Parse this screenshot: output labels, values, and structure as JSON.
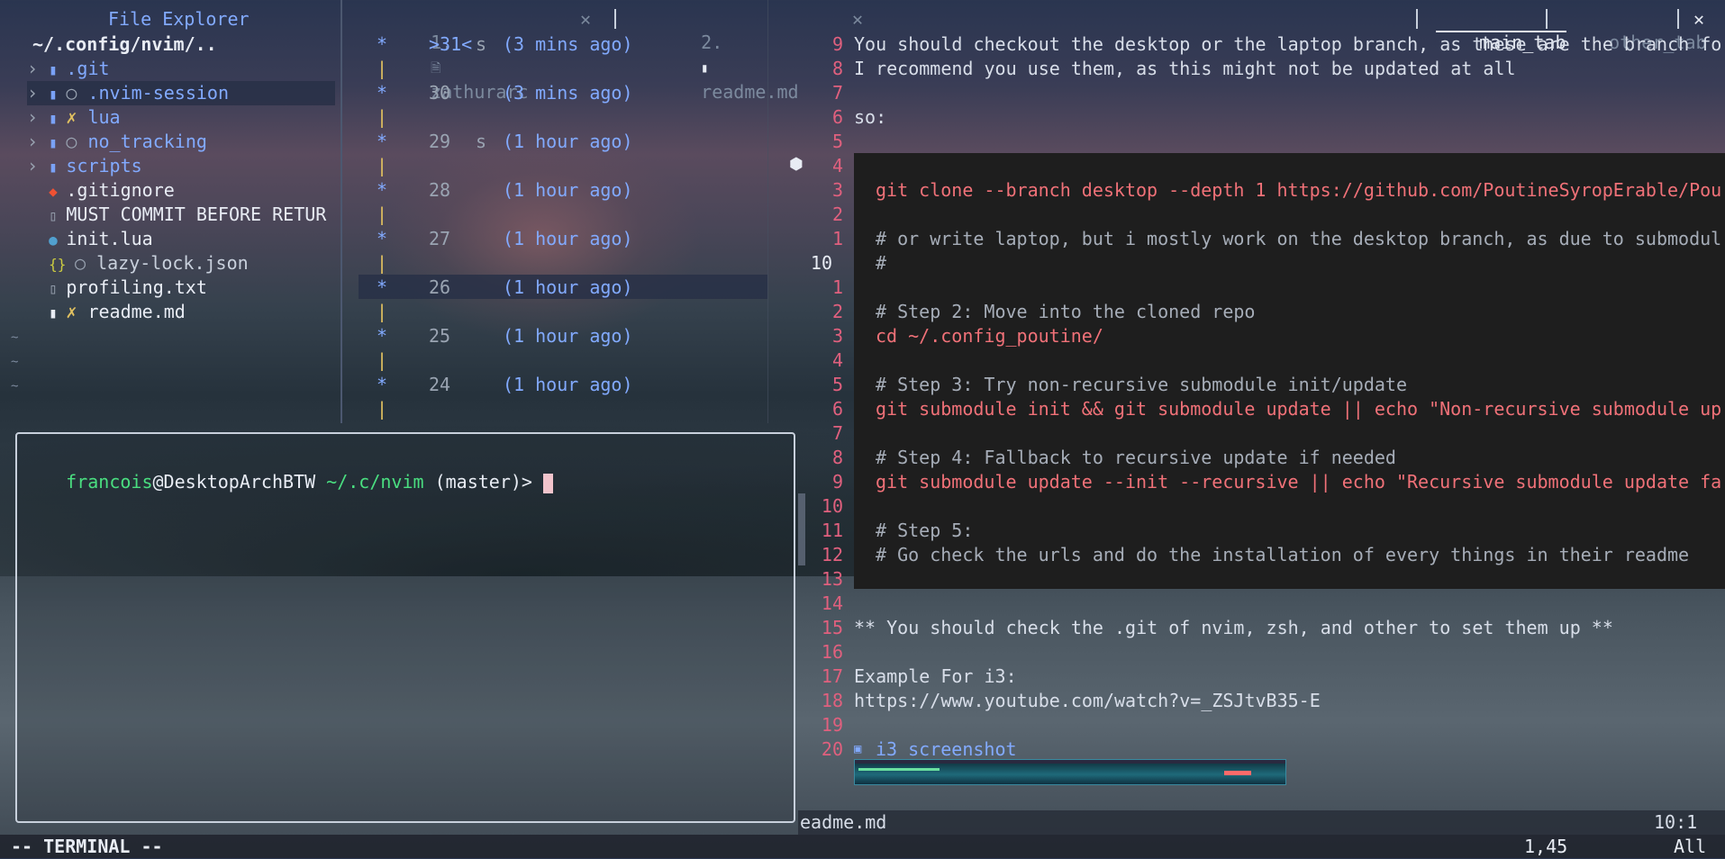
{
  "file_explorer": {
    "title": "File Explorer",
    "path": "~/.config/nvim/..",
    "items": [
      {
        "name": ".git",
        "kind": "folder",
        "mark": ""
      },
      {
        "name": ".nvim-session",
        "kind": "folder",
        "mark": "○"
      },
      {
        "name": "lua",
        "kind": "folder",
        "mark": "✗"
      },
      {
        "name": "no_tracking",
        "kind": "folder",
        "mark": "○"
      },
      {
        "name": "scripts",
        "kind": "folder",
        "mark": ""
      },
      {
        "name": ".gitignore",
        "kind": "git-file",
        "mark": ""
      },
      {
        "name": "MUST COMMIT BEFORE RETUR",
        "kind": "text-file",
        "mark": ""
      },
      {
        "name": "init.lua",
        "kind": "lua-file",
        "mark": ""
      },
      {
        "name": "lazy-lock.json",
        "kind": "json-file",
        "mark": "○"
      },
      {
        "name": "profiling.txt",
        "kind": "text-file",
        "mark": ""
      },
      {
        "name": "readme.md",
        "kind": "markdown-file",
        "mark": "✗"
      }
    ],
    "tildes": [
      "~",
      "~",
      "~"
    ]
  },
  "buffer_tabs": [
    {
      "index": "1.",
      "name": "zathurarc",
      "close": "✕"
    },
    {
      "index": "2.",
      "name": "readme.md",
      "close": "✕"
    }
  ],
  "tabpages": [
    {
      "label": "main_tab"
    },
    {
      "label": "other_tab"
    }
  ],
  "tabpage_close": "✕",
  "undotree": {
    "rows": [
      {
        "marker": "*",
        "seq": ">31<",
        "flag": "s",
        "time": "(3 mins ago)"
      },
      {
        "marker": "*",
        "seq": "30",
        "flag": "",
        "time": "(3 mins ago)"
      },
      {
        "marker": "*",
        "seq": "29",
        "flag": "s",
        "time": "(1 hour ago)"
      },
      {
        "marker": "*",
        "seq": "28",
        "flag": "",
        "time": "(1 hour ago)"
      },
      {
        "marker": "*",
        "seq": "27",
        "flag": "",
        "time": "(1 hour ago)"
      },
      {
        "marker": "*",
        "seq": "26",
        "flag": "",
        "time": "(1 hour ago)"
      },
      {
        "marker": "*",
        "seq": "25",
        "flag": "",
        "time": "(1 hour ago)"
      },
      {
        "marker": "*",
        "seq": "24",
        "flag": "",
        "time": "(1 hour ago)"
      }
    ],
    "pipe": "|"
  },
  "terminal": {
    "user": "francois",
    "host": "@DesktopArchBTW",
    "cwd": "~/.c/nvim",
    "branch": "(master)>"
  },
  "editor": {
    "lines": [
      {
        "num": "9",
        "text": "You should checkout the desktop or the laptop branch, as these are the branch fo"
      },
      {
        "num": "8",
        "text": "I recommend you use them, as this might not be updated at all"
      },
      {
        "num": "7",
        "text": ""
      },
      {
        "num": "6",
        "text": "so:"
      },
      {
        "num": "5",
        "text": ""
      },
      {
        "num": "4",
        "text": ""
      },
      {
        "num": "3",
        "text": "git clone --branch desktop --depth 1 https://github.com/PoutineSyropErable/Pou"
      },
      {
        "num": "2",
        "text": ""
      },
      {
        "num": "1",
        "text": "# or write laptop, but i mostly work on the desktop branch, as due to submodul"
      },
      {
        "num": "10",
        "text": "#"
      },
      {
        "num": "1",
        "text": ""
      },
      {
        "num": "2",
        "text": "# Step 2: Move into the cloned repo"
      },
      {
        "num": "3",
        "text": "cd ~/.config_poutine/"
      },
      {
        "num": "4",
        "text": ""
      },
      {
        "num": "5",
        "text": "# Step 3: Try non-recursive submodule init/update"
      },
      {
        "num": "6",
        "text": "git submodule init && git submodule update || echo \"Non-recursive submodule up"
      },
      {
        "num": "7",
        "text": ""
      },
      {
        "num": "8",
        "text": "# Step 4: Fallback to recursive update if needed"
      },
      {
        "num": "9",
        "text": "git submodule update --init --recursive || echo \"Recursive submodule update fa"
      },
      {
        "num": "10",
        "text": ""
      },
      {
        "num": "11",
        "text": "# Step 5:"
      },
      {
        "num": "12",
        "text": "# Go check the urls and do the installation of every things in their readme"
      },
      {
        "num": "13",
        "text": ""
      },
      {
        "num": "14",
        "text": ""
      },
      {
        "num": "15",
        "text": "** You should check the .git of nvim, zsh, and other to set them up **"
      },
      {
        "num": "16",
        "text": ""
      },
      {
        "num": "17",
        "text": "Example For i3:"
      },
      {
        "num": "18",
        "text": "https://www.youtube.com/watch?v=_ZSJtvB35-E"
      },
      {
        "num": "19",
        "text": ""
      },
      {
        "num": "20",
        "text": "i3 screenshot"
      }
    ],
    "winbar_file": "eadme.md",
    "winbar_pos": "10:1"
  },
  "statusline": {
    "mode": "-- TERMINAL --",
    "cursor": "1,45",
    "scroll": "All"
  },
  "colors": {
    "accent": "#82aaff",
    "line_number": "#e0607e",
    "terminal_user": "#4ade80",
    "code_block_bg": "#1e1e1e"
  }
}
